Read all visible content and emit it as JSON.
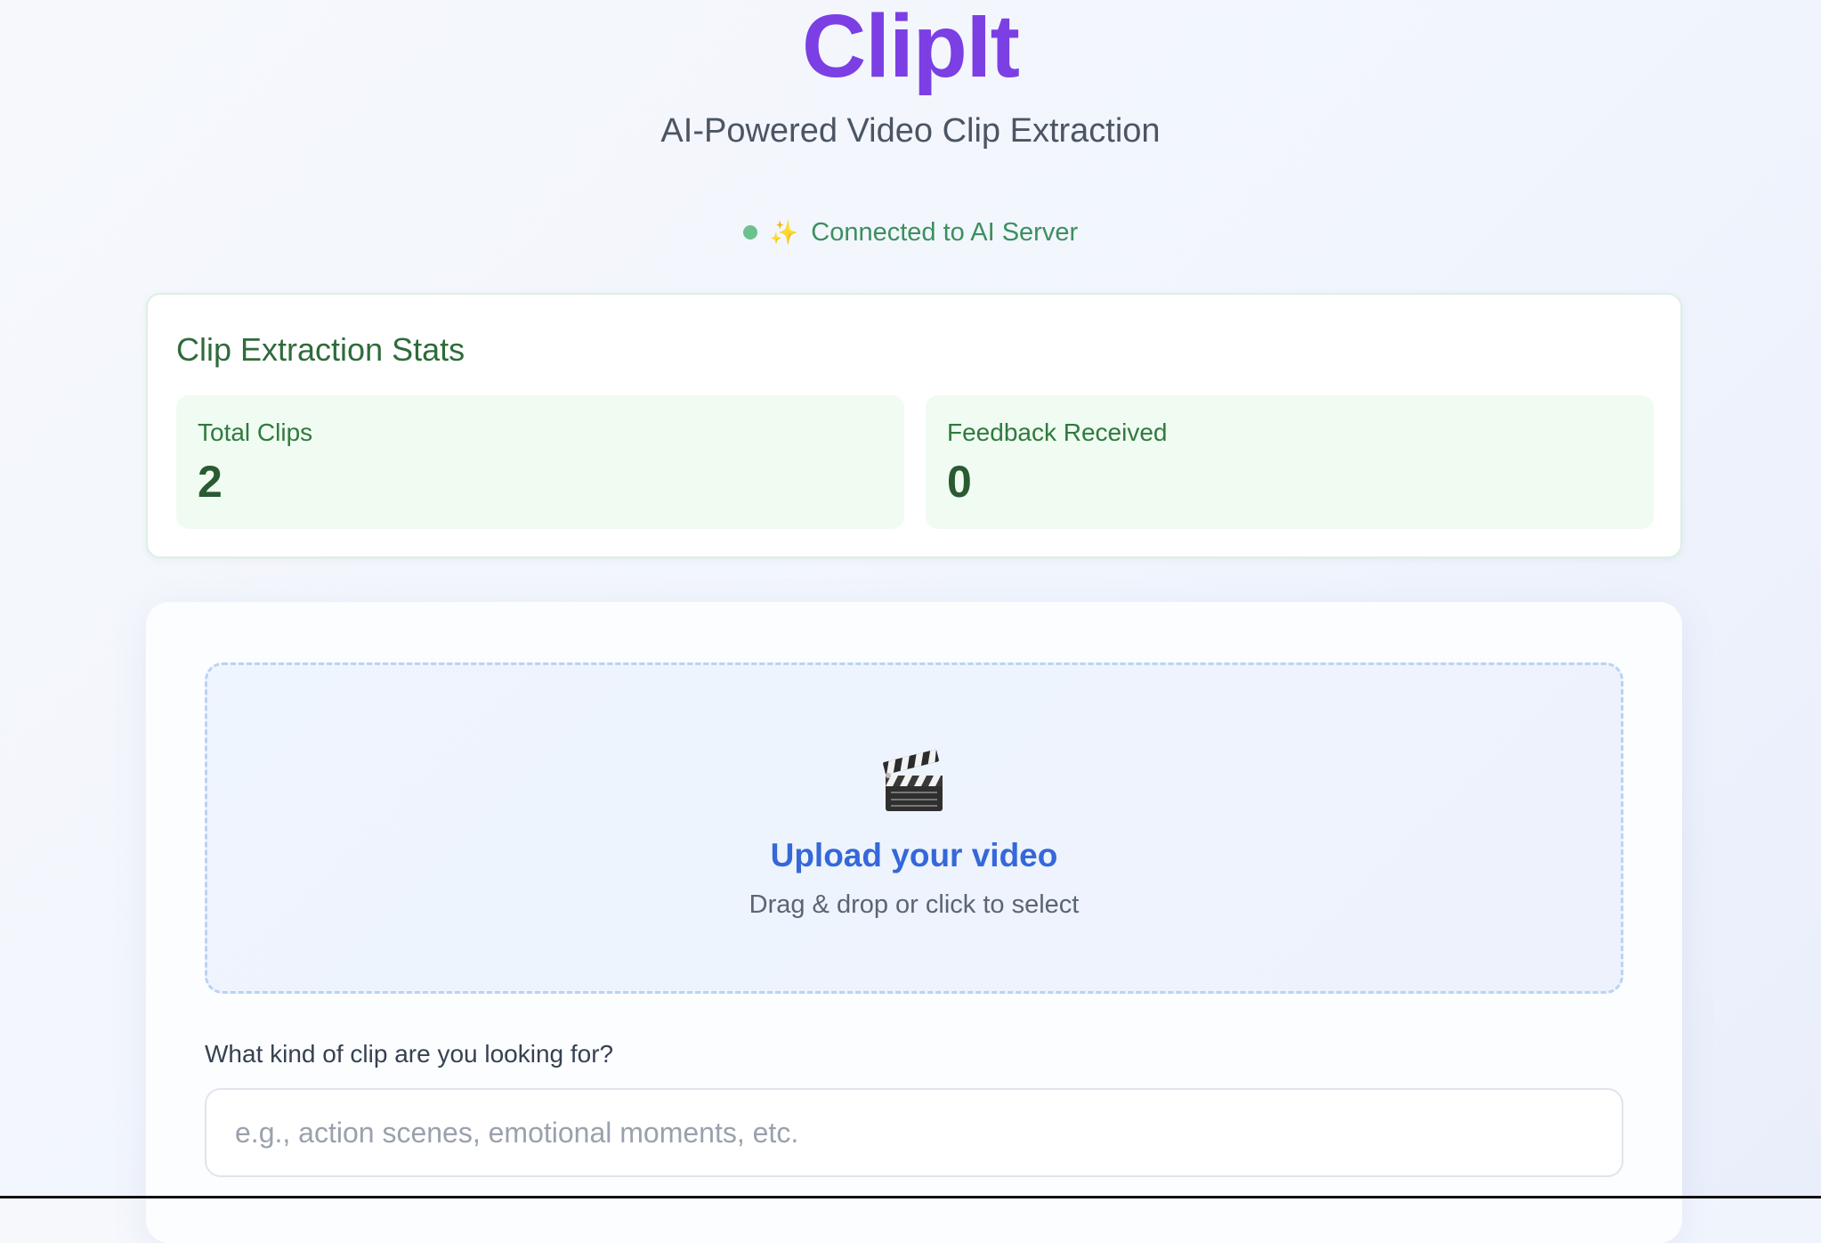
{
  "header": {
    "brand": "ClipIt",
    "tagline": "AI-Powered Video Clip Extraction"
  },
  "status": {
    "text": "Connected to AI Server",
    "indicator_color": "#6cc18f",
    "icon": "sparkles-icon"
  },
  "stats": {
    "title": "Clip Extraction Stats",
    "items": [
      {
        "label": "Total Clips",
        "value": "2"
      },
      {
        "label": "Feedback Received",
        "value": "0"
      }
    ]
  },
  "upload": {
    "icon": "clapper-board-icon",
    "title": "Upload your video",
    "subtitle": "Drag & drop or click to select"
  },
  "prompt": {
    "label": "What kind of clip are you looking for?",
    "placeholder": "e.g., action scenes, emotional moments, etc.",
    "value": ""
  },
  "colors": {
    "brand": "#7b3fe4",
    "accent": "#3568d8",
    "success": "#3c8f5f"
  }
}
